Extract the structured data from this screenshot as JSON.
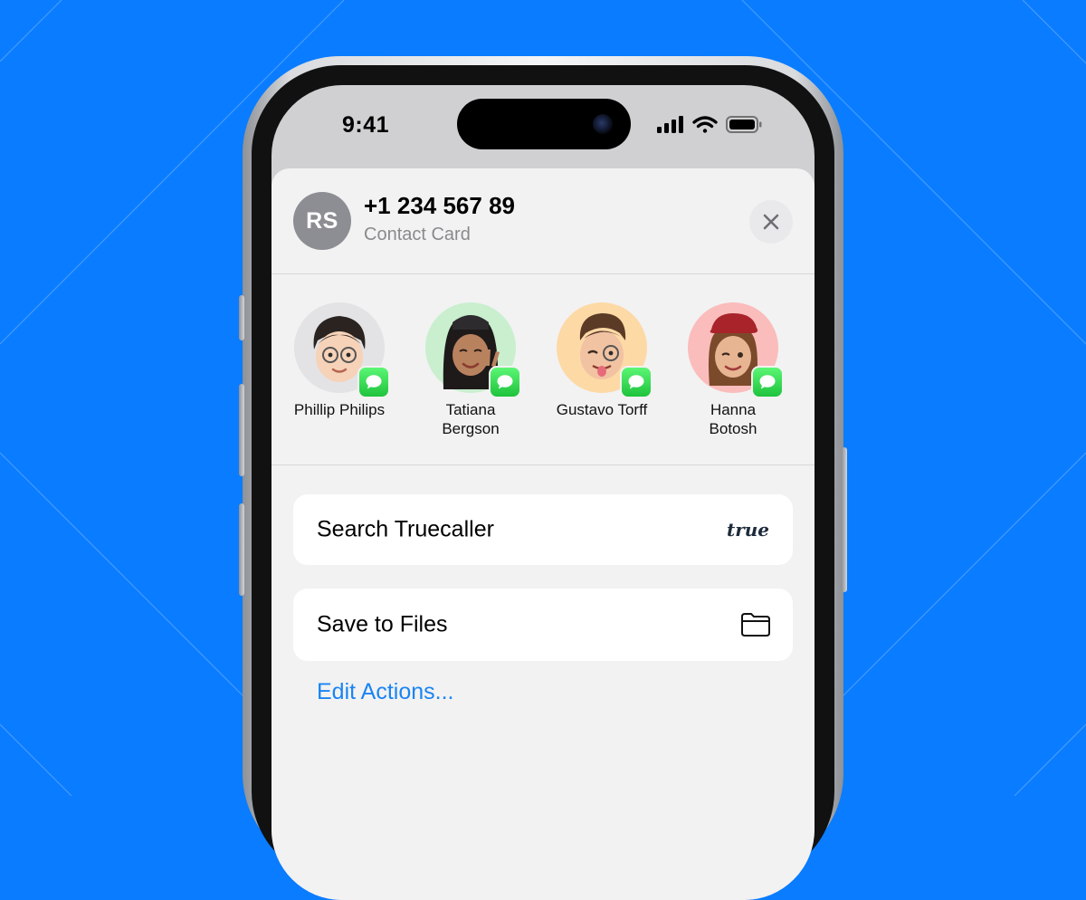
{
  "status_bar": {
    "time": "9:41"
  },
  "contact": {
    "initials": "RS",
    "number": "+1 234 567 89",
    "subtitle": "Contact Card"
  },
  "people": [
    {
      "name": "Phillip Philips",
      "bg": "#e3e3e5",
      "badge": "messages-icon"
    },
    {
      "name": "Tatiana\nBergson",
      "bg": "#c9efcf",
      "badge": "messages-icon"
    },
    {
      "name": "Gustavo Torff",
      "bg": "#fdd9a6",
      "badge": "messages-icon"
    },
    {
      "name": "Hanna\nBotosh",
      "bg": "#fbbcbc",
      "badge": "messages-icon"
    }
  ],
  "actions": [
    {
      "label": "Search Truecaller",
      "icon": "truecaller-logo",
      "logo_text": "true"
    },
    {
      "label": "Save to Files",
      "icon": "folder-icon"
    }
  ],
  "edit_actions_label": "Edit Actions...",
  "colors": {
    "background": "#0a7cff",
    "link": "#1a84f4",
    "messages_green": "#2ed24b"
  }
}
